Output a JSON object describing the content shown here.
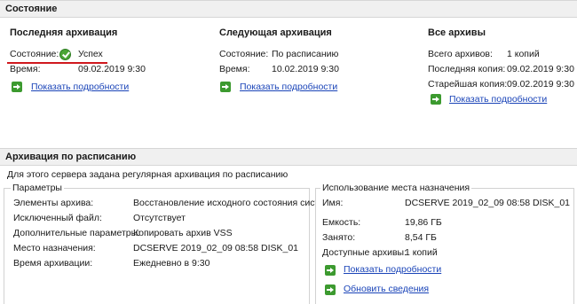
{
  "status_header": "Состояние",
  "last": {
    "title": "Последняя архивация",
    "state_label": "Состояние:",
    "state_value": "Успех",
    "time_label": "Время:",
    "time_value": "09.02.2019 9:30",
    "link": "Показать подробности"
  },
  "next": {
    "title": "Следующая архивация",
    "state_label": "Состояние:",
    "state_value": "По расписанию",
    "time_label": "Время:",
    "time_value": "10.02.2019 9:30",
    "link": "Показать подробности"
  },
  "all": {
    "title": "Все архивы",
    "total_label": "Всего архивов:",
    "total_value": "1 копий",
    "last_label": "Последняя копия:",
    "last_value": "09.02.2019 9:30",
    "oldest_label": "Старейшая копия:",
    "oldest_value": "09.02.2019 9:30",
    "link": "Показать подробности"
  },
  "schedule_header": "Архивация по расписанию",
  "schedule_desc": "Для этого сервера задана регулярная архивация по расписанию",
  "params": {
    "title": "Параметры",
    "rows": [
      {
        "label": "Элементы архива:",
        "value": "Восстановление исходного состояния сист..."
      },
      {
        "label": "Исключенный файл:",
        "value": "Отсутствует"
      },
      {
        "label": "Дополнительные параметры:",
        "value": "Копировать архив VSS"
      },
      {
        "label": "Место назначения:",
        "value": "DCSERVE 2019_02_09 08:58 DISK_01"
      },
      {
        "label": "Время архивации:",
        "value": "Ежедневно в 9:30"
      }
    ]
  },
  "dest": {
    "title": "Использование места назначения",
    "rows": [
      {
        "label": "Имя:",
        "value": "DCSERVE 2019_02_09 08:58 DISK_01"
      },
      {
        "label": "Емкость:",
        "value": "19,86 ГБ"
      },
      {
        "label": "Занято:",
        "value": "8,54 ГБ"
      },
      {
        "label": "Доступные архивы:",
        "value": "1 копий"
      }
    ],
    "link_details": "Показать подробности",
    "link_refresh": "Обновить сведения"
  },
  "colors": {
    "link": "#1a44b8",
    "underline_red": "#d0191e",
    "ok_green": "#4aa535"
  }
}
